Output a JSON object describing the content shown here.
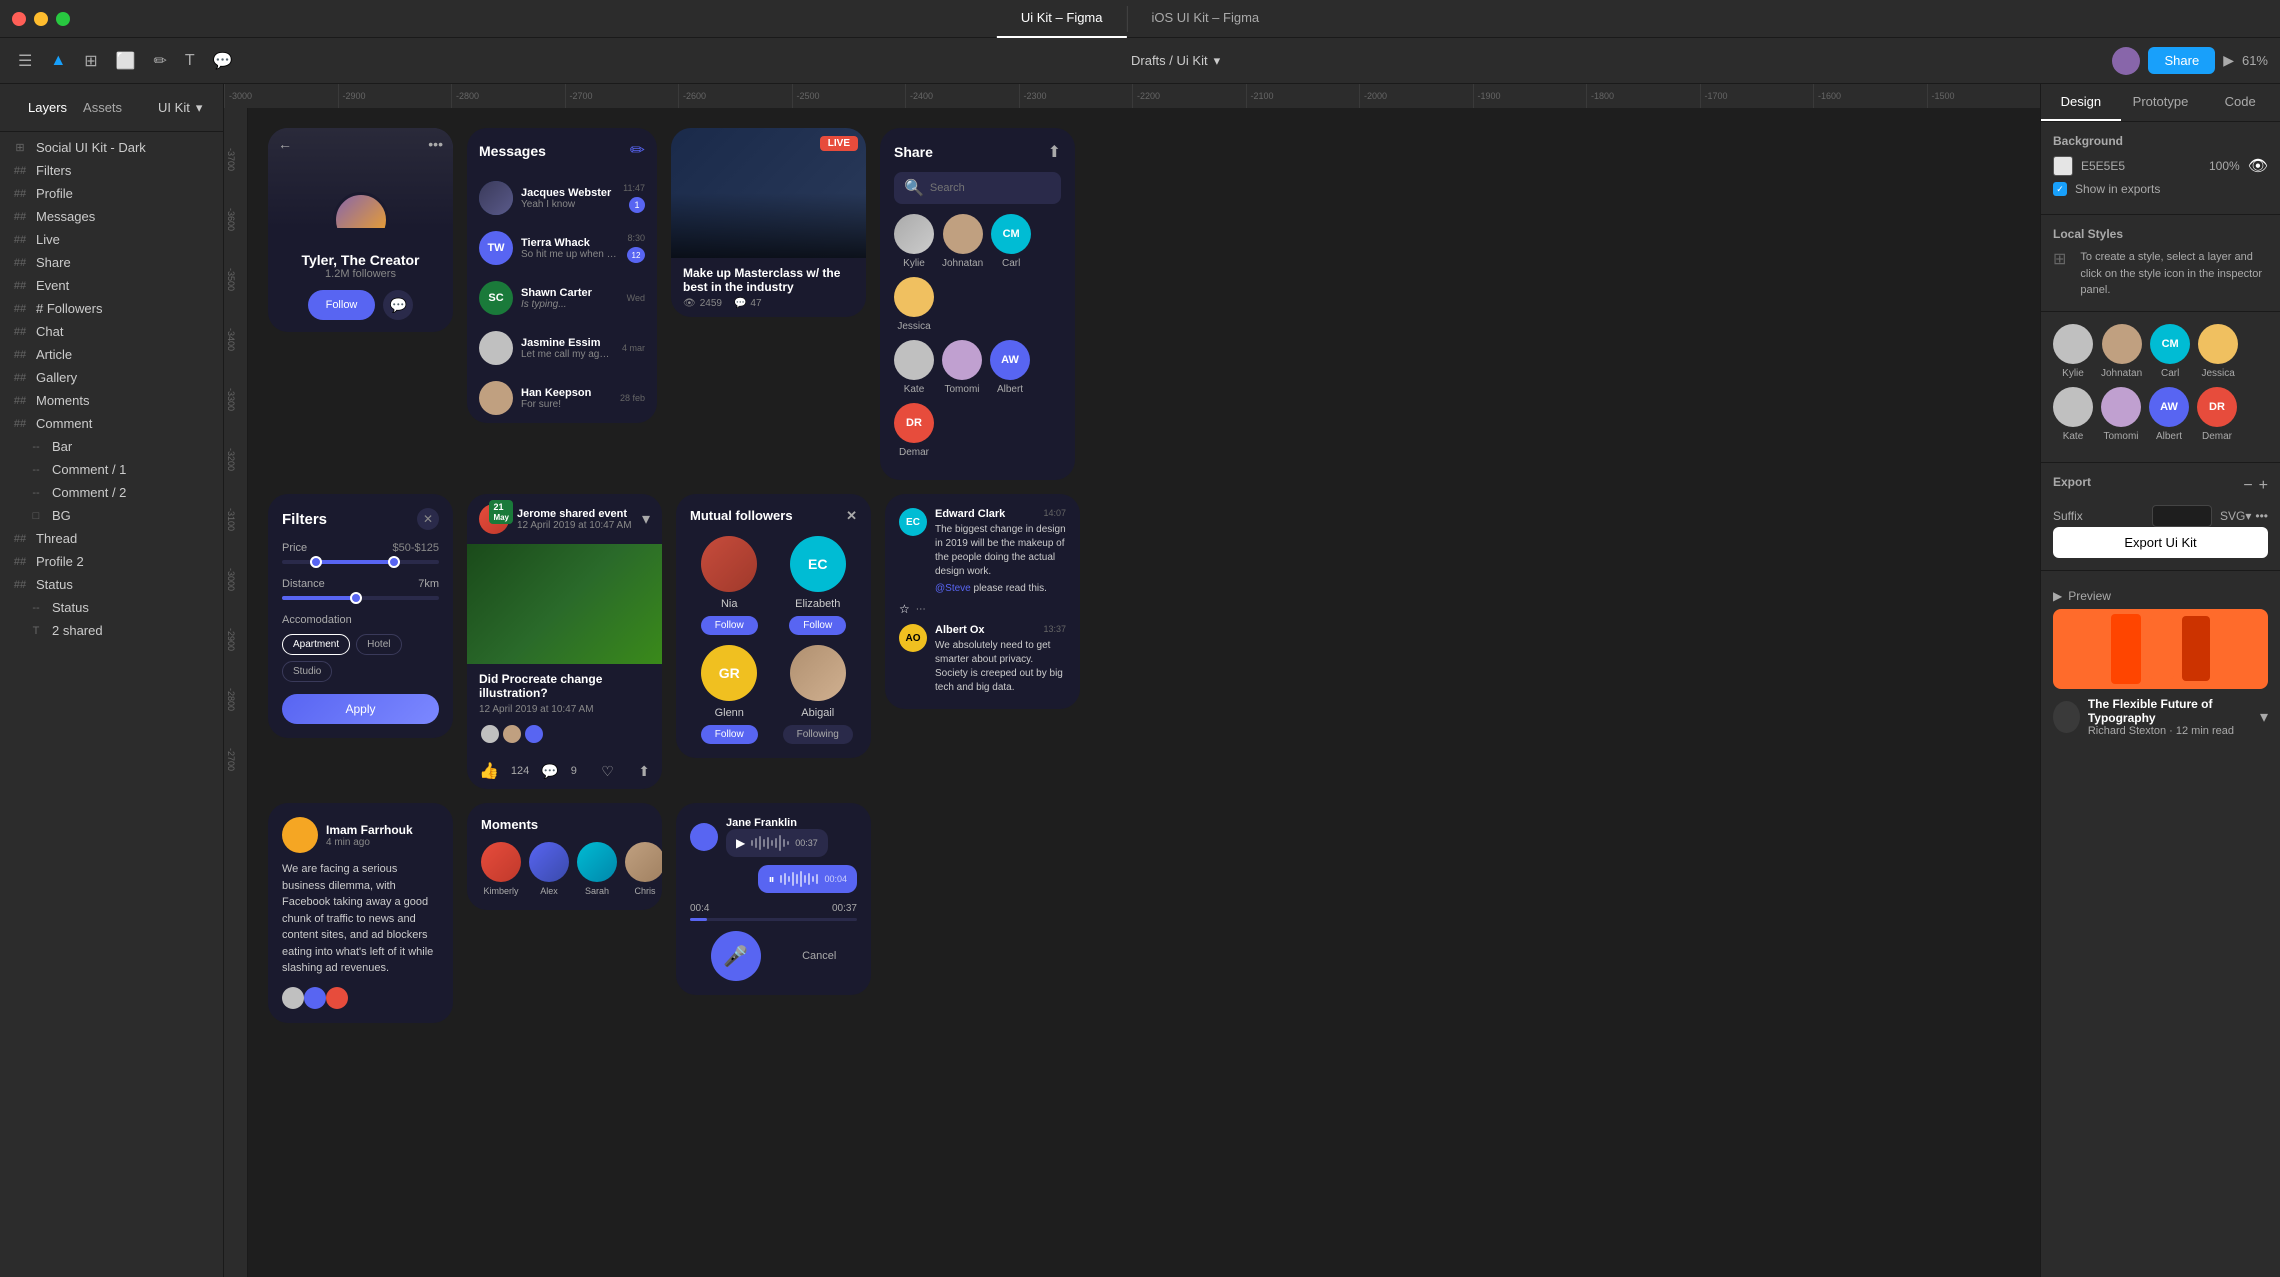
{
  "app": {
    "title": "Ui Kit – Figma",
    "tab1": "Ui Kit – Figma",
    "tab2": "iOS UI Kit – Figma"
  },
  "toolbar": {
    "breadcrumb": "Drafts / Ui Kit",
    "zoom": "61%"
  },
  "sidebar": {
    "layers_tab": "Layers",
    "assets_tab": "Assets",
    "kit_label": "UI Kit",
    "root_item": "Social UI Kit - Dark",
    "items": [
      {
        "label": "Filters",
        "icon": "##"
      },
      {
        "label": "Profile",
        "icon": "##"
      },
      {
        "label": "Messages",
        "icon": "##"
      },
      {
        "label": "Live",
        "icon": "##"
      },
      {
        "label": "Share",
        "icon": "##"
      },
      {
        "label": "Event",
        "icon": "##"
      },
      {
        "label": "Followers",
        "icon": "##"
      },
      {
        "label": "Chat",
        "icon": "##"
      },
      {
        "label": "Article",
        "icon": "##"
      },
      {
        "label": "Gallery",
        "icon": "##"
      },
      {
        "label": "Moments",
        "icon": "##"
      },
      {
        "label": "Comment",
        "icon": "##"
      },
      {
        "label": "Bar",
        "icon": "--",
        "sub": true
      },
      {
        "label": "Comment / 1",
        "icon": "--",
        "sub": true
      },
      {
        "label": "Comment / 2",
        "icon": "--",
        "sub": true
      },
      {
        "label": "BG",
        "icon": "□",
        "sub": true
      },
      {
        "label": "Thread",
        "icon": "##"
      },
      {
        "label": "Profile 2",
        "icon": "##"
      },
      {
        "label": "Status",
        "icon": "##"
      },
      {
        "label": "Status",
        "icon": "--",
        "sub": true
      },
      {
        "label": "2 shared",
        "icon": "T"
      }
    ]
  },
  "design_panel": {
    "tabs": [
      "Design",
      "Prototype",
      "Code"
    ],
    "active_tab": "Design",
    "background_label": "Background",
    "bg_color": "E5E5E5",
    "bg_opacity": "100%",
    "show_exports_label": "Show in exports",
    "local_styles_label": "Local Styles",
    "local_styles_info": "To create a style, select a layer and click on the style icon in the inspector panel.",
    "export_label": "Export",
    "suffix_label": "Suffix",
    "suffix_format": "SVG",
    "export_btn": "Export Ui Kit",
    "preview_label": "Preview",
    "preview_title": "The Flexible Future of Typography",
    "preview_author": "Richard Stexton · 12 min read",
    "avatars": [
      {
        "name": "Kylie",
        "bg": "#c0c0c0",
        "initials": ""
      },
      {
        "name": "Johnatan",
        "bg": "#c0a080",
        "initials": ""
      },
      {
        "name": "Carl",
        "bg": "#00bcd4",
        "initials": "CM"
      },
      {
        "name": "Jessica",
        "bg": "#f0c060",
        "initials": ""
      },
      {
        "name": "Kate",
        "bg": "#c0c0c0",
        "initials": ""
      },
      {
        "name": "Tomomi",
        "bg": "#c0a0d0",
        "initials": ""
      },
      {
        "name": "Albert",
        "bg": "#5865f2",
        "initials": "AW"
      },
      {
        "name": "Demar",
        "bg": "#e74c3c",
        "initials": "DR"
      }
    ]
  },
  "canvas": {
    "ruler_marks": [
      "-3000",
      "-2900",
      "-2800",
      "-2700",
      "-2600",
      "-2500",
      "-2400",
      "-2300",
      "-2200",
      "-2100",
      "-2000",
      "-1900",
      "-1800",
      "-1700",
      "-1600",
      "-1500"
    ]
  },
  "profile_card": {
    "name": "Tyler, The Creator",
    "followers": "1.2M followers",
    "follow_btn": "Follow"
  },
  "messages_card": {
    "items": [
      {
        "name": "Jacques Webster",
        "text": "Yeah I know",
        "time": "11:47",
        "avatar_bg": "#2a4a8a"
      },
      {
        "name": "Tierra Whack",
        "text": "So hit me up when you're...",
        "time": "8:30",
        "avatar_bg": "#5865f2",
        "initials": "TW"
      },
      {
        "name": "Shawn Carter",
        "text": "Is typing...",
        "time": "Wed",
        "avatar_bg": "#1a7a3a",
        "initials": "SC"
      },
      {
        "name": "Jasmine Essim",
        "text": "Let me call my agency",
        "time": "4 mar",
        "avatar_bg": "#c0c0c0"
      },
      {
        "name": "Han Keepson",
        "text": "For sure!",
        "time": "28 feb",
        "avatar_bg": "#c0a080"
      }
    ]
  },
  "filters_card": {
    "title": "Filters",
    "price_label": "Price",
    "price_range": "$50-$125",
    "distance_label": "Distance",
    "distance_value": "7km",
    "accommodation_label": "Accomodation",
    "tags": [
      "Apartment",
      "Hotel",
      "Studio"
    ],
    "apply_btn": "Apply"
  },
  "live_card": {
    "title": "Make up Masterclass w/ the best in the industry",
    "badge": "LIVE",
    "views": "2459",
    "comments": "47"
  },
  "mutual_followers": {
    "title": "Mutual followers",
    "followers": [
      {
        "name": "Nia",
        "bg": "#e74c3c",
        "initials": "",
        "btn": "Follow"
      },
      {
        "name": "Elizabeth",
        "bg": "#00bcd4",
        "initials": "EC",
        "btn": "Follow"
      },
      {
        "name": "Glenn",
        "bg": "#f0c020",
        "initials": "GR",
        "btn": "Follow"
      },
      {
        "name": "Abigail",
        "bg": "#c0a080",
        "initials": "",
        "btn": "Following"
      }
    ]
  },
  "post_card": {
    "date_badge": "21 May",
    "author": "Jerome shared event",
    "date": "12 April 2019 at 10:47 AM",
    "title": "Did Procreate change illustration?",
    "sub_date": "12 April 2019 at 10:47 AM",
    "likes": "124",
    "comments": "9"
  },
  "thread_card": {
    "name": "Imam Farrhouk",
    "time": "4 min ago",
    "body": "We are facing a serious business dilemma, with Facebook taking away a good chunk of traffic to news and content sites, and ad blockers eating into what's left of it while slashing ad revenues."
  },
  "chat_card": {
    "user1": "Edward Clark",
    "time1": "14:07",
    "msg1": "The biggest change in design in 2019 will be the makeup of the people doing the actual design work.",
    "mention": "@Steve",
    "mention_end": "please read this.",
    "user2": "Albert Ox",
    "time2": "13:37",
    "msg2": "We absolutely need to get smarter about privacy. Society is creeped out by big tech and big data."
  },
  "moments_card": {
    "title": "Moments",
    "people": [
      {
        "name": "Kimberly",
        "bg": "#e74c3c"
      },
      {
        "name": "Alex",
        "bg": "#5865f2"
      },
      {
        "name": "Sarah",
        "bg": "#00bcd4"
      },
      {
        "name": "Chris",
        "bg": "#c0a080"
      }
    ]
  },
  "recording_card": {
    "time_start": "00:4",
    "time_end": "00:37",
    "cancel": "Cancel",
    "jane": "Jane Franklin",
    "msg_time": "00:37",
    "msg2_time": "00:04"
  },
  "share_panel": {
    "title": "Share",
    "search_placeholder": "Search"
  }
}
